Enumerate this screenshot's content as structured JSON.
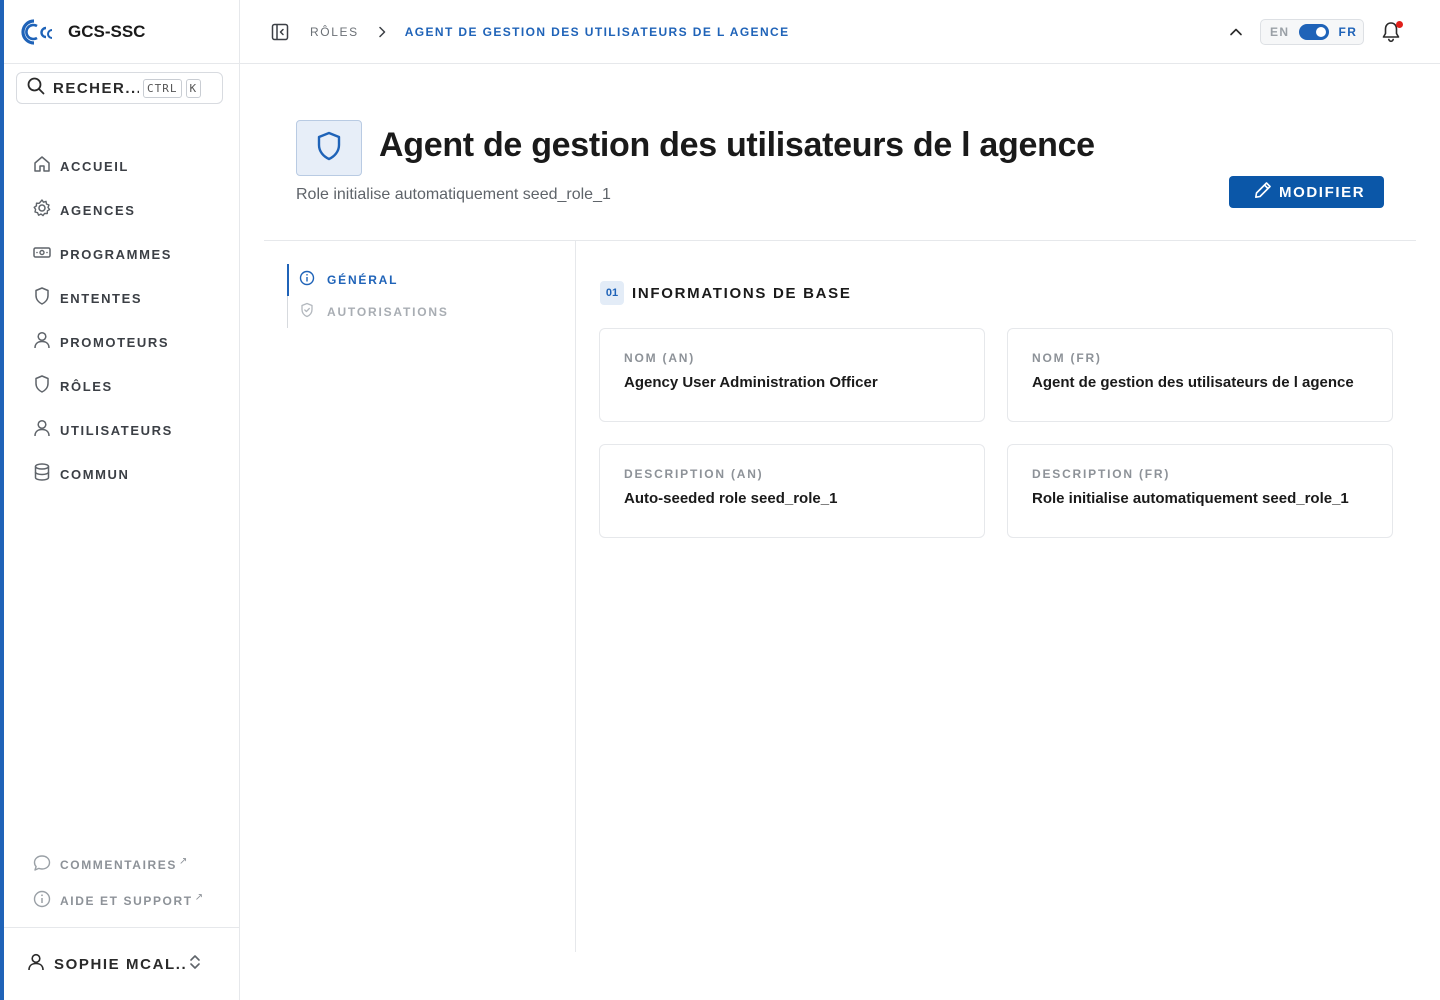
{
  "brand": {
    "name": "GCS-SSC",
    "logo_icon": "gcs-ssc-logo"
  },
  "search": {
    "label": "RECHER...",
    "shortcut_keys": [
      "CTRL",
      "K"
    ]
  },
  "sidebar": {
    "items": [
      {
        "label": "ACCUEIL",
        "icon": "home-icon"
      },
      {
        "label": "AGENCES",
        "icon": "gear-icon"
      },
      {
        "label": "PROGRAMMES",
        "icon": "banknote-icon"
      },
      {
        "label": "ENTENTES",
        "icon": "shield-icon"
      },
      {
        "label": "PROMOTEURS",
        "icon": "user-icon"
      },
      {
        "label": "RÔLES",
        "icon": "shield-icon"
      },
      {
        "label": "UTILISATEURS",
        "icon": "user-icon"
      },
      {
        "label": "COMMUN",
        "icon": "database-icon"
      }
    ],
    "footer": [
      {
        "label": "COMMENTAIRES",
        "icon": "message-icon"
      },
      {
        "label": "AIDE ET SUPPORT",
        "icon": "info-icon"
      }
    ],
    "user": {
      "name": "SOPHIE MCAL..."
    }
  },
  "topbar": {
    "breadcrumb": [
      "RÔLES",
      "AGENT DE GESTION DES UTILISATEURS DE L AGENCE"
    ],
    "lang": {
      "en": "EN",
      "fr": "FR",
      "selected": "FR"
    },
    "notification_indicator": true
  },
  "page": {
    "title": "Agent de gestion des utilisateurs de l agence",
    "subtitle": "Role initialise automatiquement seed_role_1",
    "edit_label": "MODIFIER"
  },
  "sections_nav": [
    {
      "label": "GÉNÉRAL",
      "active": true
    },
    {
      "label": "AUTORISATIONS",
      "active": false
    }
  ],
  "section": {
    "number": "01",
    "title": "INFORMATIONS DE BASE",
    "fields": [
      {
        "label": "NOM (AN)",
        "value": "Agency User Administration Officer"
      },
      {
        "label": "NOM (FR)",
        "value": "Agent de gestion des utilisateurs de l agence"
      },
      {
        "label": "DESCRIPTION (AN)",
        "value": "Auto-seeded role seed_role_1"
      },
      {
        "label": "DESCRIPTION (FR)",
        "value": "Role initialise automatiquement seed_role_1"
      }
    ]
  },
  "colors": {
    "accent": "#1f63b8",
    "button": "#0b57a8",
    "alert_dot": "#e0201b"
  }
}
